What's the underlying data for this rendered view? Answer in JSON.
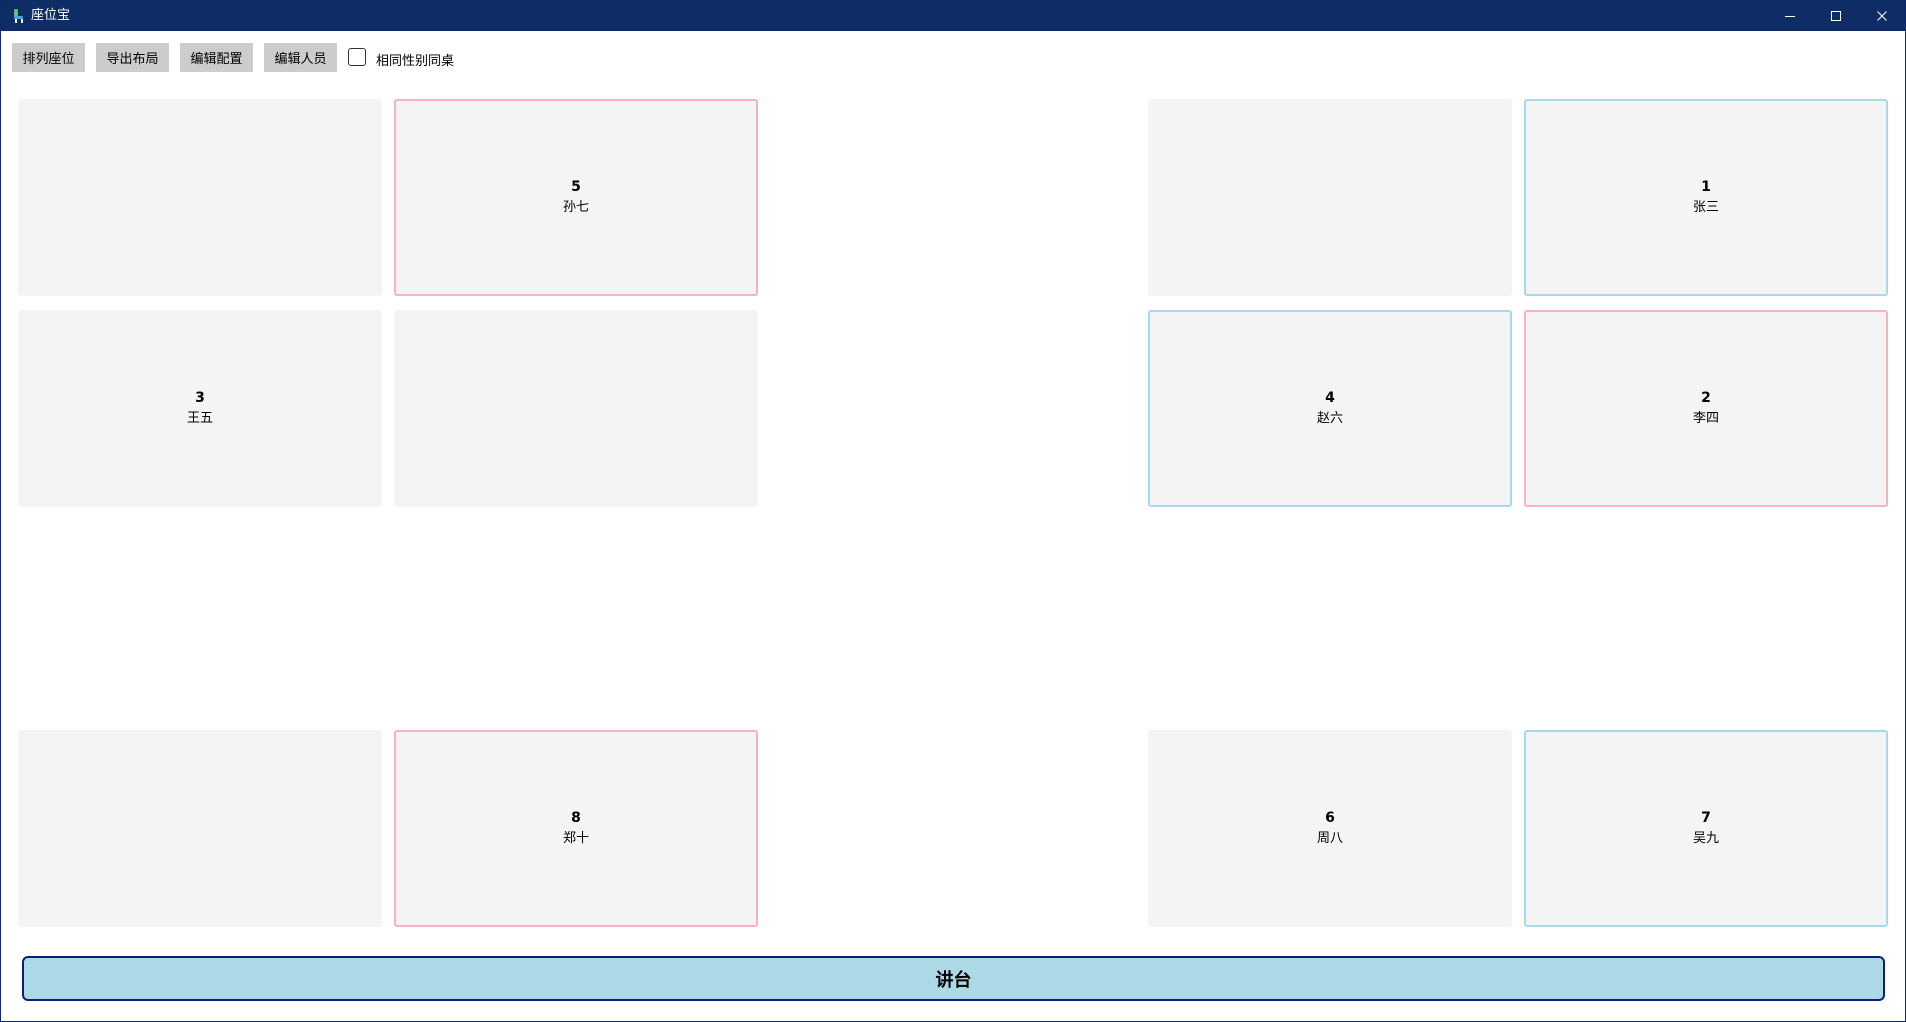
{
  "window": {
    "title": "座位宝",
    "titlebar_color": "#0e2c66",
    "controls": [
      "minimize-icon",
      "maximize-icon",
      "close-icon"
    ]
  },
  "toolbar": {
    "arrange_label": "排列座位",
    "export_label": "导出布局",
    "config_label": "编辑配置",
    "people_label": "编辑人员",
    "same_gender_label": "相同性别同桌",
    "same_gender_checked": false
  },
  "colors": {
    "female_border": "#f7b3c0",
    "male_border": "#a8d8ec",
    "seat_background": "#f4f4f4",
    "podium_background": "#add8e6",
    "podium_border": "#0a1f7a"
  },
  "seats": {
    "r1c1": {
      "number": "",
      "name": "",
      "gender": ""
    },
    "r1c2": {
      "number": "5",
      "name": "孙七",
      "gender": "female"
    },
    "r1c3": {
      "number": "",
      "name": "",
      "gender": ""
    },
    "r1c4": {
      "number": "1",
      "name": "张三",
      "gender": "male"
    },
    "r2c1": {
      "number": "3",
      "name": "王五",
      "gender": ""
    },
    "r2c2": {
      "number": "",
      "name": "",
      "gender": ""
    },
    "r2c3": {
      "number": "4",
      "name": "赵六",
      "gender": "male"
    },
    "r2c4": {
      "number": "2",
      "name": "李四",
      "gender": "female"
    },
    "r3c1": {
      "number": "",
      "name": "",
      "gender": ""
    },
    "r3c2": {
      "number": "8",
      "name": "郑十",
      "gender": "female"
    },
    "r3c3": {
      "number": "6",
      "name": "周八",
      "gender": ""
    },
    "r3c4": {
      "number": "7",
      "name": "吴九",
      "gender": "male"
    }
  },
  "podium": {
    "label": "讲台"
  }
}
